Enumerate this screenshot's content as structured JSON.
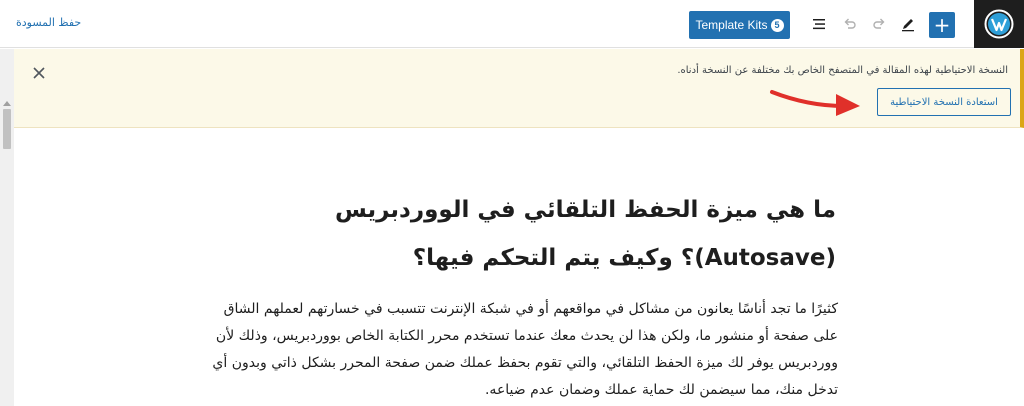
{
  "toolbar": {
    "template_kits_label": "Template Kits",
    "template_kits_badge": "5",
    "save_draft_label": "حفظ المسودة"
  },
  "notice": {
    "message": "النسخة الاحتياطية لهذه المقالة في المتصفح الخاص بك مختلفة عن النسخة أدناه.",
    "restore_button_label": "استعادة النسخة الاحتياطية"
  },
  "post": {
    "heading": "ما هي ميزة الحفظ التلقائي في الووردبريس (Autosave)؟ وكيف يتم التحكم فيها؟",
    "paragraph": "كثيرًا ما تجد أناسًا يعانون من مشاكل في مواقعهم أو في شبكة الإنترنت تتسبب في خسارتهم لعملهم الشاق على صفحة أو منشور ما، ولكن هذا لن يحدث معك عندما تستخدم محرر الكتابة الخاص بووردبريس، وذلك لأن ووردبريس يوفر لك ميزة الحفظ التلقائي، والتي تقوم بحفظ عملك ضمن صفحة المحرر بشكل ذاتي وبدون أي تدخل منك، مما سيضمن لك حماية عملك وضمان عدم ضياعه."
  },
  "colors": {
    "accent": "#2271b1",
    "notice_bg": "#fcf9e8",
    "notice_border": "#dba617",
    "arrow": "#e0302a"
  }
}
